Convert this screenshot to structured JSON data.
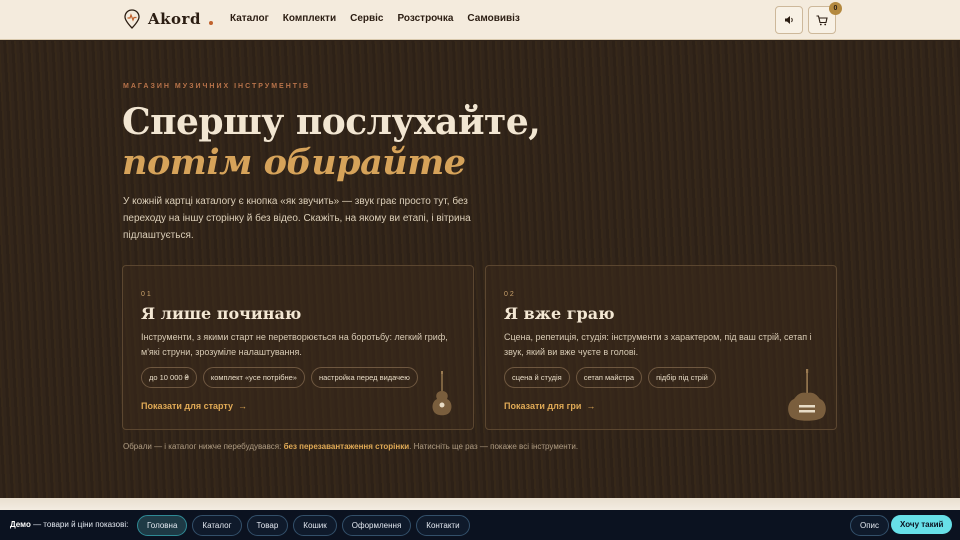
{
  "header": {
    "brand": "Akord",
    "nav": [
      "Каталог",
      "Комплекти",
      "Сервіс",
      "Розстрочка",
      "Самовивіз"
    ],
    "cart_count": "0",
    "icons": [
      "pin-icon",
      "speaker-icon",
      "cart-icon"
    ]
  },
  "hero": {
    "eyebrow": "МАГАЗИН МУЗИЧНИХ ІНСТРУМЕНТІВ",
    "title_line1": "Спершу послухайте,",
    "title_line2": "потім обирайте",
    "lead": "У кожній картці каталогу є кнопка «як звучить» — звук грає просто тут, без переходу на іншу сторінку й без відео. Скажіть, на якому ви етапі, і вітрина підлаштується.",
    "cards": [
      {
        "num": "01",
        "title": "Я лише починаю",
        "text": "Інструменти, з якими старт не перетворюється на боротьбу: легкий гриф, м'які струни, зрозуміле налаштування.",
        "tags": [
          "до 10 000 ₴",
          "комплект «усе потрібне»",
          "настройка перед видачею"
        ],
        "link": "Показати для старту"
      },
      {
        "num": "02",
        "title": "Я вже граю",
        "text": "Сцена, репетиція, студія: інструменти з характером, під ваш стрій, сетап і звук, який ви вже чуєте в голові.",
        "tags": [
          "сцена й студія",
          "сетап майстра",
          "підбір під стрій"
        ],
        "link": "Показати для гри"
      }
    ],
    "note_prefix": "Обрали — і каталог нижче перебудувався:",
    "note_bold": "без перезавантаження сторінки",
    "note_suffix": ". Натисніть ще раз — покаже всі інструменти."
  },
  "demobar": {
    "label_bold": "Демо",
    "label_rest": " — товари й ціни показові:",
    "pages": [
      "Головна",
      "Каталог",
      "Товар",
      "Кошик",
      "Оформлення",
      "Контакти"
    ],
    "active_page": "Головна",
    "about": "Опис",
    "cta": "Хочу такий"
  },
  "colors": {
    "accent": "#d6a35a",
    "header_bg": "#f4ebdd",
    "hero_bg": "#2e2218",
    "demobar_bg": "#0b1220",
    "cta": "#67e0e8"
  }
}
